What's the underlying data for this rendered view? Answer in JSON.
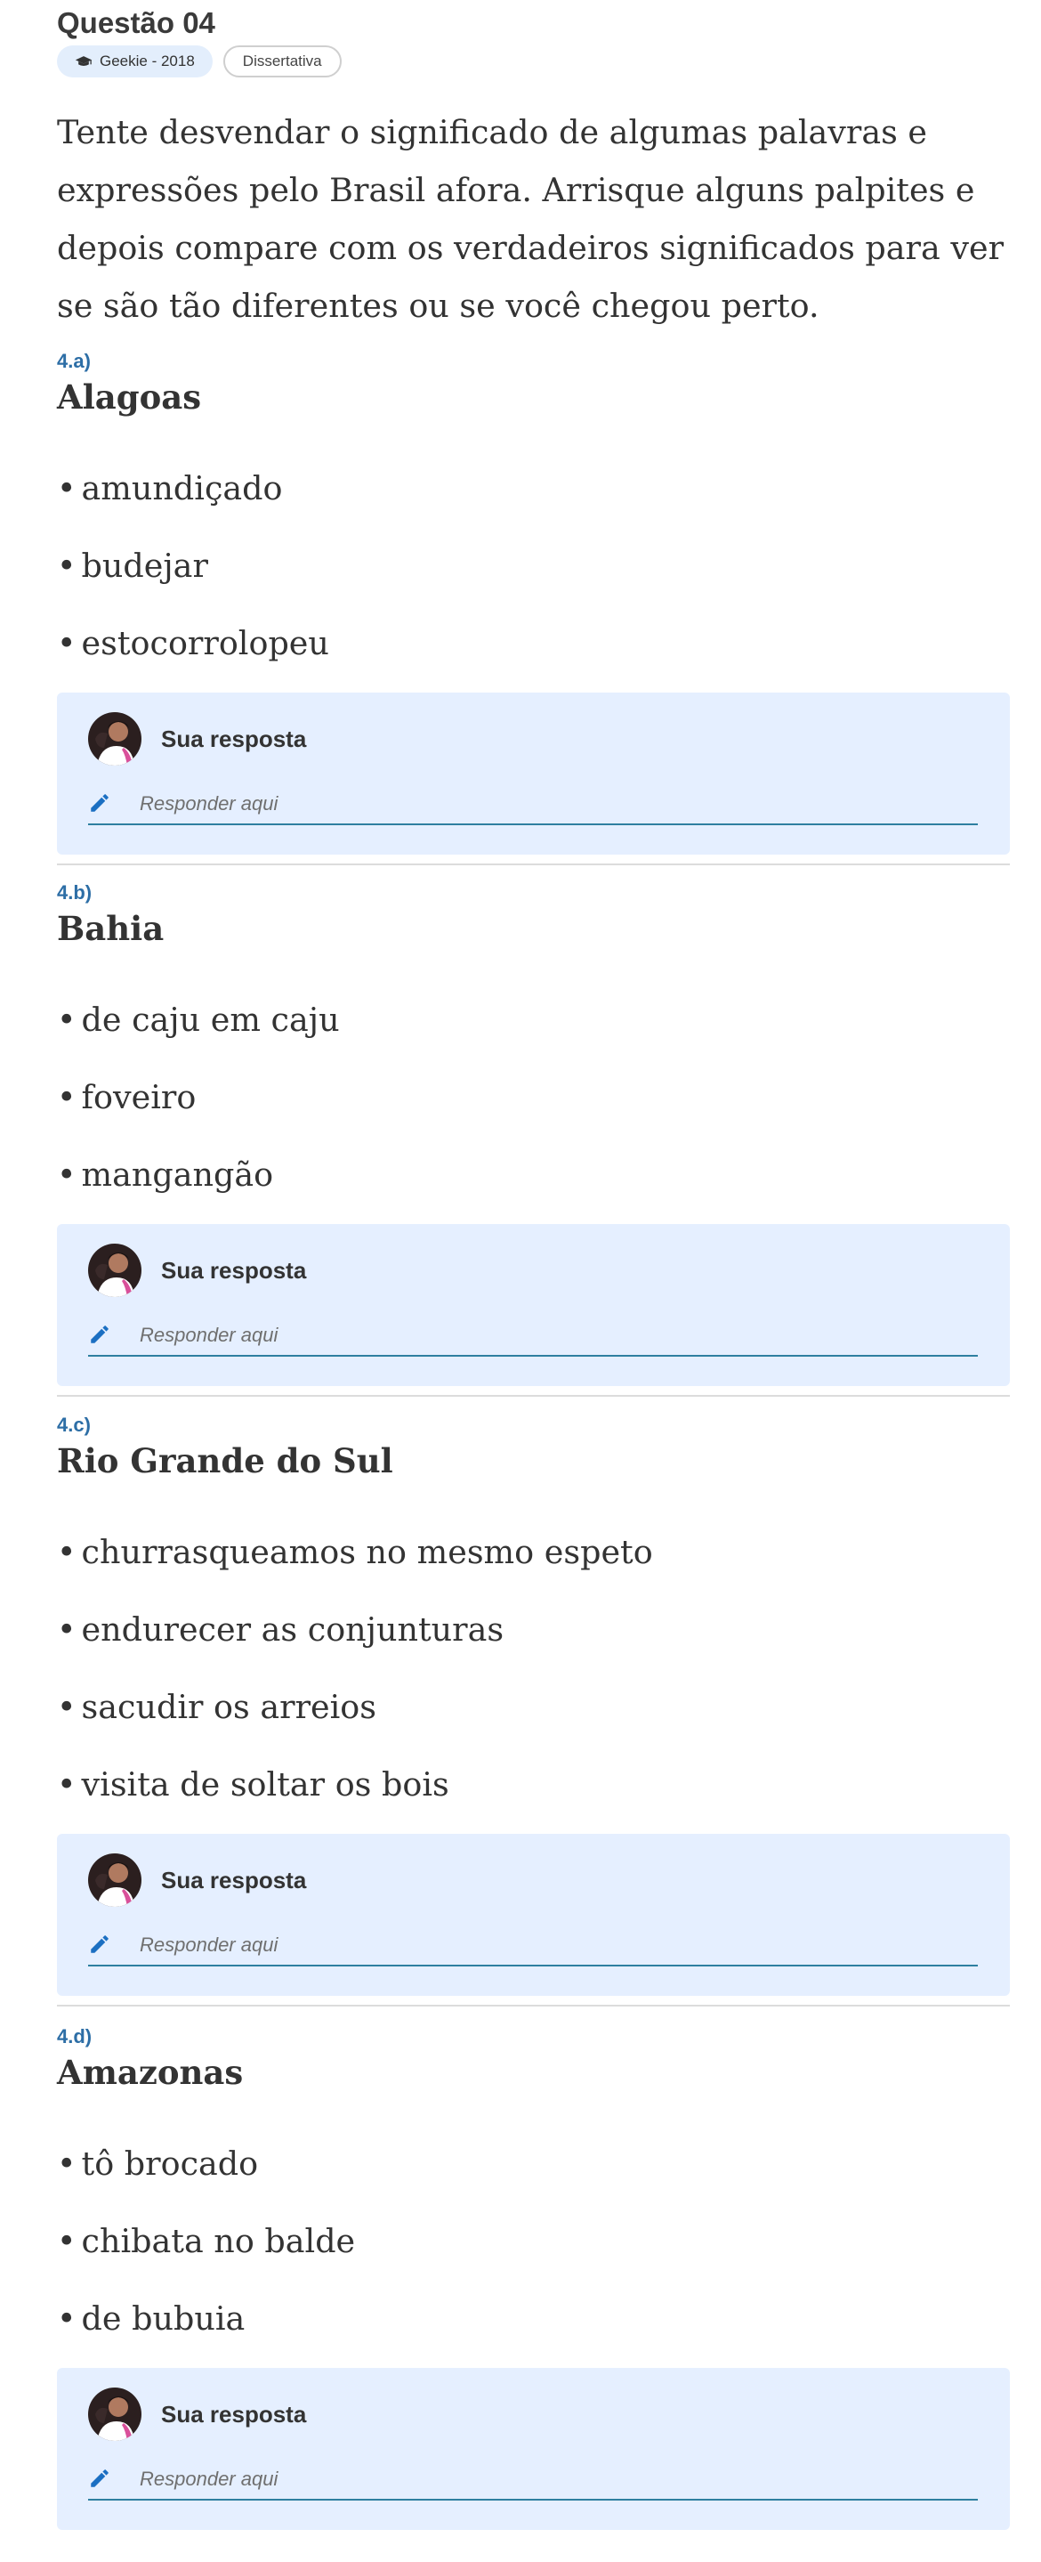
{
  "question": {
    "title": "Questão 04",
    "source_badge": "Geekie - 2018",
    "type_badge": "Dissertativa",
    "intro": "Tente desvendar o significado de algumas palavras e expressões pelo Brasil afora. Arrisque alguns palpites e depois compare com os verdadeiros significados para ver se são tão diferentes ou se você chegou perto."
  },
  "sections": [
    {
      "label": "4.a)",
      "title": "Alagoas",
      "items": [
        "amundiçado",
        "budejar",
        "estocorrolopeu"
      ],
      "answer_label": "Sua resposta",
      "answer_placeholder": "Responder aqui",
      "answer_value": ""
    },
    {
      "label": "4.b)",
      "title": "Bahia",
      "items": [
        "de caju em caju",
        "foveiro",
        "mangangão"
      ],
      "answer_label": "Sua resposta",
      "answer_placeholder": "Responder aqui",
      "answer_value": ""
    },
    {
      "label": "4.c)",
      "title": "Rio Grande do Sul",
      "items": [
        "churrasqueamos no mesmo espeto",
        "endurecer as conjunturas",
        "sacudir os arreios",
        "visita de soltar os bois"
      ],
      "answer_label": "Sua resposta",
      "answer_placeholder": "Responder aqui",
      "answer_value": ""
    },
    {
      "label": "4.d)",
      "title": "Amazonas",
      "items": [
        "tô brocado",
        "chibata no balde",
        "de bubuia"
      ],
      "answer_label": "Sua resposta",
      "answer_placeholder": "Responder aqui",
      "answer_value": ""
    }
  ],
  "bullet": "•",
  "icons": {
    "badge": "graduation-cap-icon",
    "answer": "pencil-icon",
    "avatar": "user-avatar"
  },
  "colors": {
    "accent": "#2d6ea6",
    "answer_bg": "#e5efff",
    "badge_bg": "#e3eefc",
    "underline": "#2e7fa0",
    "pencil": "#1b6fc2"
  }
}
